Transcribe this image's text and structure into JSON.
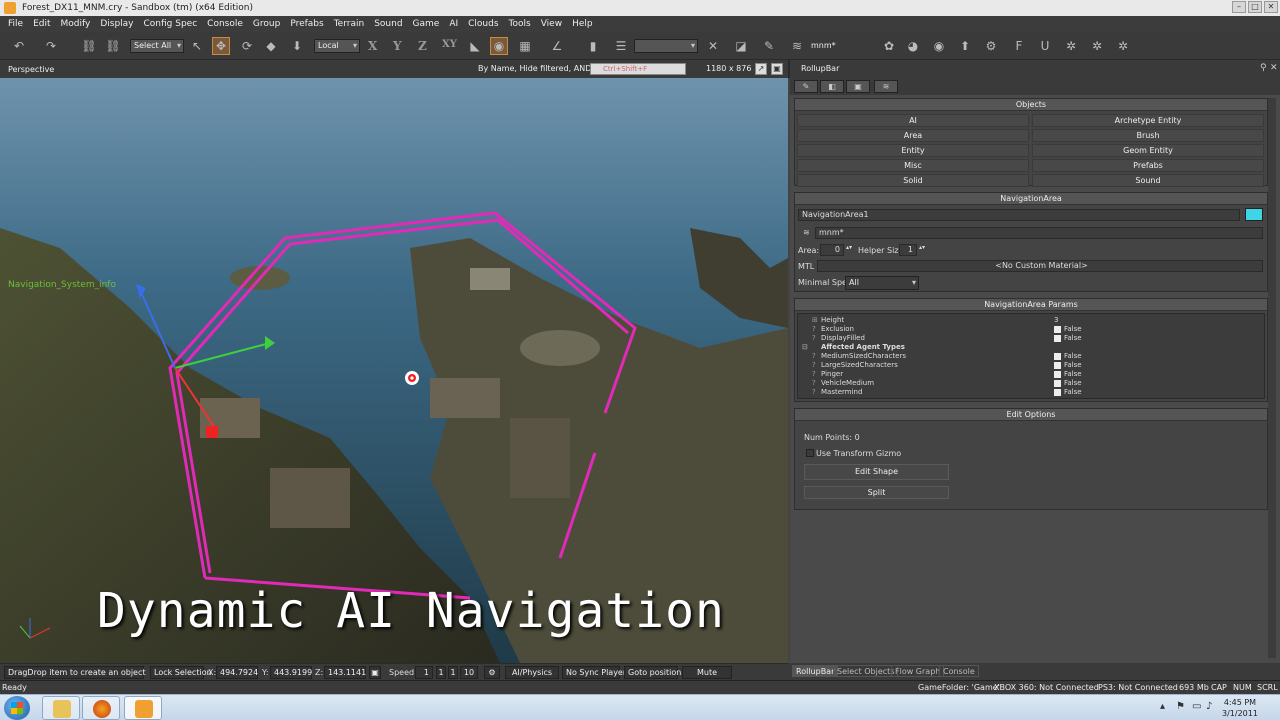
{
  "window": {
    "title": "Forest_DX11_MNM.cry - Sandbox (tm) (x64 Edition)"
  },
  "menu": [
    "File",
    "Edit",
    "Modify",
    "Display",
    "Config Spec",
    "Console",
    "Group",
    "Prefabs",
    "Terrain",
    "Sound",
    "Game",
    "AI",
    "Clouds",
    "Tools",
    "View",
    "Help"
  ],
  "toolbar": {
    "select_filter": "Select All",
    "coord_system": "Local",
    "axis_labels": [
      "X",
      "Y",
      "Z",
      "XY"
    ],
    "layer_value": "mnm*"
  },
  "viewport": {
    "title": "Perspective",
    "filter_text": "By Name, Hide filtered, AND",
    "search_placeholder": "Ctrl+Shift+F",
    "resolution": "1180 x 876",
    "overlay_title": "Dynamic AI Navigation",
    "nav_label": "Navigation_System_info"
  },
  "rollup": {
    "title": "RollupBar",
    "objects": {
      "header": "Objects",
      "left": [
        "AI",
        "Area",
        "Entity",
        "Misc",
        "Solid"
      ],
      "right": [
        "Archetype Entity",
        "Brush",
        "Geom Entity",
        "Prefabs",
        "Sound"
      ]
    },
    "nav_area": {
      "header": "NavigationArea",
      "name": "NavigationArea1",
      "color": "#3fd4e6",
      "layer": "mnm*",
      "area_label": "Area:",
      "area_value": "0",
      "helper_label": "Helper Size:",
      "helper_value": "1",
      "mtl_label": "MTL",
      "mtl_value": "<No Custom Material>",
      "minspec_label": "Minimal Spec:",
      "minspec_value": "All"
    },
    "params": {
      "header": "NavigationArea Params",
      "height_label": "Height",
      "height_value": "3",
      "rows": [
        {
          "name": "Exclusion",
          "value": "False"
        },
        {
          "name": "DisplayFilled",
          "value": "False"
        }
      ],
      "category": "Affected Agent Types",
      "agents": [
        {
          "name": "MediumSizedCharacters",
          "value": "False"
        },
        {
          "name": "LargeSizedCharacters",
          "value": "False"
        },
        {
          "name": "Pinger",
          "value": "False"
        },
        {
          "name": "VehicleMedium",
          "value": "False"
        },
        {
          "name": "Mastermind",
          "value": "False"
        }
      ]
    },
    "edit": {
      "header": "Edit Options",
      "num_points": "Num Points: 0",
      "gizmo_label": "Use Transform Gizmo",
      "edit_shape": "Edit Shape",
      "split": "Split"
    }
  },
  "status": {
    "hint": "DragDrop item to create an object",
    "lock": "Lock Selection",
    "x_label": "X:",
    "x": "494.7924",
    "y_label": "Y:",
    "y": "443.9199",
    "z_label": "Z:",
    "z": "143.1141",
    "speed_label": "Speed:",
    "speed_value": "1",
    "speed_opts": [
      "1",
      "1",
      "10"
    ],
    "ai_physics": "AI/Physics",
    "no_sync": "No Sync Player",
    "goto": "Goto position",
    "mute": "Mute"
  },
  "bottom_tabs": [
    "RollupBar",
    "Select Objects",
    "Flow Graph",
    "Console"
  ],
  "readybar": {
    "ready": "Ready",
    "game_folder": "GameFolder: 'Game'",
    "xbox": "XBOX 360: Not Connected",
    "ps3": "PS3: Not Connected",
    "mem": "693 Mb",
    "caps": "CAP",
    "num": "NUM",
    "scrl": "SCRL"
  },
  "taskbar": {
    "time": "4:45 PM",
    "date": "3/1/2011"
  }
}
